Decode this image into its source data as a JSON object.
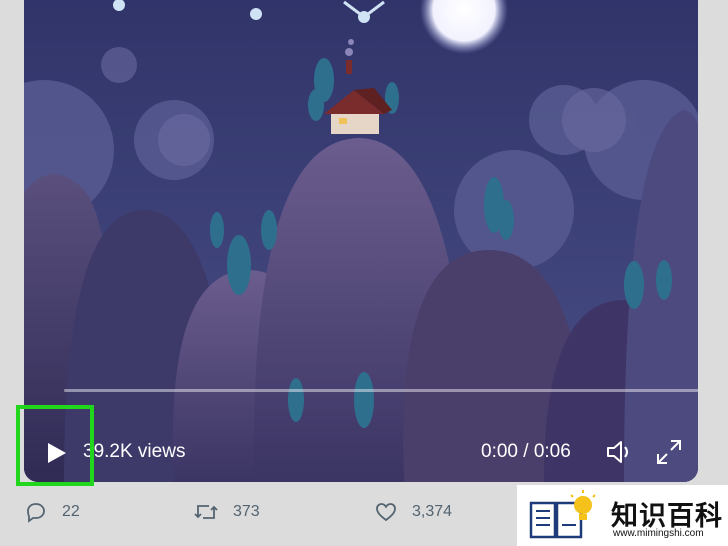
{
  "player": {
    "views": "39.2K views",
    "time": "0:00 / 0:06",
    "progress": 0
  },
  "tweet_actions": {
    "replies": "22",
    "retweets": "373",
    "likes": "3,374"
  },
  "watermark": {
    "title": "知识百科",
    "url": "www.mimingshi.com"
  },
  "colors": {
    "highlight": "#22d61d",
    "video_bg": "#3a3f72",
    "action_text": "#536471"
  }
}
